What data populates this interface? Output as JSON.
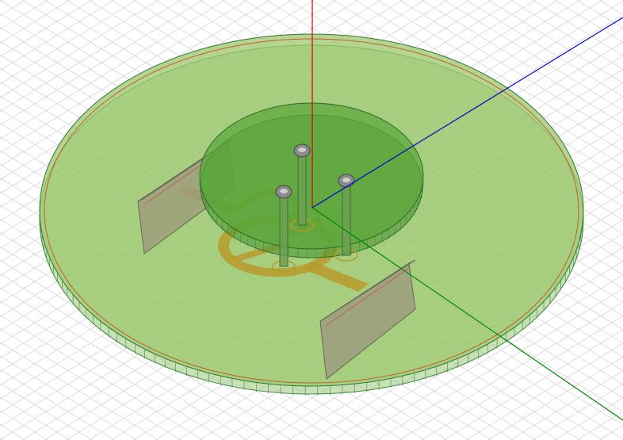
{
  "viewport": {
    "background": "#ffffff",
    "grid_color": "#d0d0d0"
  },
  "axes": {
    "z_color": "#dd0000",
    "x_color": "#0000cc",
    "y_color": "#008800"
  },
  "model": {
    "substrate_fill": "#8cc060",
    "substrate_edge": "#3c8a3c",
    "copper_ring": "#c06030",
    "superstrate_fill": "#5aa83a",
    "feed_trace_fill": "#b89a2a",
    "plate_fill": "#9c9c7c",
    "probe_fill": "#8a8a8a",
    "probe_count": 3,
    "plate_count": 2
  }
}
